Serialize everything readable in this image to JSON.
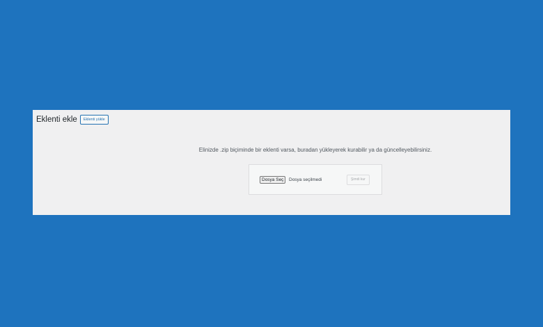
{
  "header": {
    "title": "Eklenti ekle",
    "upload_button_label": "Eklenti yükle"
  },
  "upload": {
    "help_text": "Elinizde .zip biçiminde bir eklenti varsa, buradan yükleyerek kurabilir ya da güncelleyebilirsiniz.",
    "choose_file_label": "Dosya Seç",
    "file_status": "Dosya seçilmedi",
    "install_button_label": "Şimdi kur",
    "install_button_disabled": true
  },
  "colors": {
    "background": "#1e73be",
    "panel": "#f0f0f1",
    "accent": "#2271b1"
  }
}
